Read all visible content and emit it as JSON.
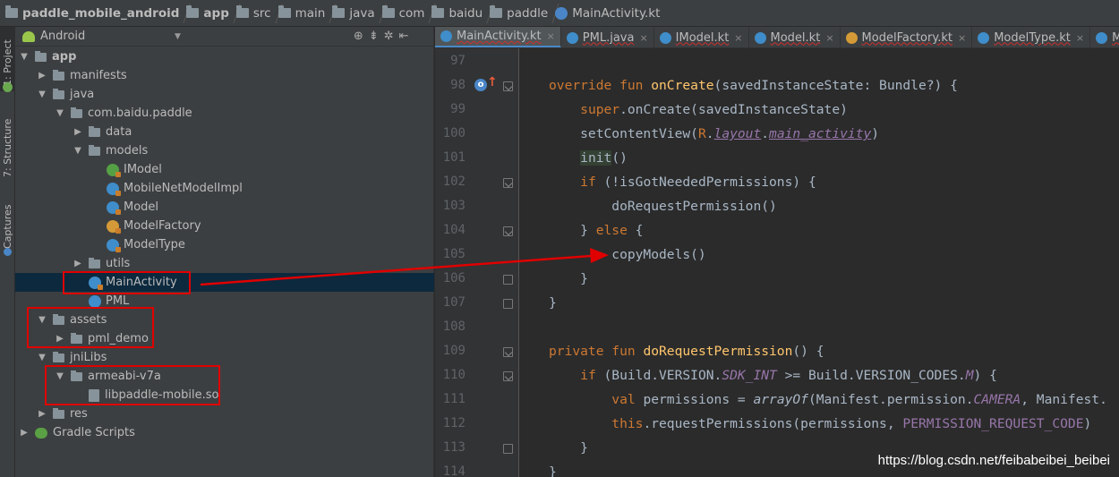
{
  "breadcrumb": [
    {
      "label": "paddle_mobile_android",
      "bold": true,
      "icon": "project-folder-icon"
    },
    {
      "label": "app",
      "bold": true,
      "icon": "module-folder-icon"
    },
    {
      "label": "src",
      "bold": false,
      "icon": "folder-icon"
    },
    {
      "label": "main",
      "bold": false,
      "icon": "folder-icon"
    },
    {
      "label": "java",
      "bold": false,
      "icon": "folder-icon"
    },
    {
      "label": "com",
      "bold": false,
      "icon": "folder-icon"
    },
    {
      "label": "baidu",
      "bold": false,
      "icon": "folder-icon"
    },
    {
      "label": "paddle",
      "bold": false,
      "icon": "folder-icon"
    },
    {
      "label": "MainActivity.kt",
      "bold": false,
      "icon": "kotlin-class-icon"
    }
  ],
  "toolstrip": {
    "project_tab": "1: Project",
    "structure_tab": "7: Structure",
    "captures_tab": "Captures"
  },
  "project_panel": {
    "view_mode": "Android",
    "tree": [
      {
        "label": "app",
        "bold": true,
        "arrow": "down",
        "indent": 0,
        "icon": "module"
      },
      {
        "label": "manifests",
        "arrow": "right",
        "indent": 1,
        "icon": "folder"
      },
      {
        "label": "java",
        "arrow": "down",
        "indent": 1,
        "icon": "folder"
      },
      {
        "label": "com.baidu.paddle",
        "arrow": "down",
        "indent": 2,
        "icon": "folder"
      },
      {
        "label": "data",
        "arrow": "right",
        "indent": 3,
        "icon": "folder"
      },
      {
        "label": "models",
        "arrow": "down",
        "indent": 3,
        "icon": "folder"
      },
      {
        "label": "IModel",
        "arrow": "",
        "indent": 4,
        "icon": "interface"
      },
      {
        "label": "MobileNetModelImpl",
        "arrow": "",
        "indent": 4,
        "icon": "class"
      },
      {
        "label": "Model",
        "arrow": "",
        "indent": 4,
        "icon": "class"
      },
      {
        "label": "ModelFactory",
        "arrow": "",
        "indent": 4,
        "icon": "class-orange"
      },
      {
        "label": "ModelType",
        "arrow": "",
        "indent": 4,
        "icon": "class"
      },
      {
        "label": "utils",
        "arrow": "right",
        "indent": 3,
        "icon": "folder"
      },
      {
        "label": "MainActivity",
        "arrow": "",
        "indent": 3,
        "icon": "class",
        "selected": true
      },
      {
        "label": "PML",
        "arrow": "",
        "indent": 3,
        "icon": "class-java"
      },
      {
        "label": "assets",
        "arrow": "down",
        "indent": 1,
        "icon": "folder"
      },
      {
        "label": "pml_demo",
        "arrow": "right",
        "indent": 2,
        "icon": "folder"
      },
      {
        "label": "jniLibs",
        "arrow": "down",
        "indent": 1,
        "icon": "folder"
      },
      {
        "label": "armeabi-v7a",
        "arrow": "down",
        "indent": 2,
        "icon": "folder"
      },
      {
        "label": "libpaddle-mobile.so",
        "arrow": "",
        "indent": 3,
        "icon": "so-file"
      },
      {
        "label": "res",
        "arrow": "right",
        "indent": 1,
        "icon": "folder"
      },
      {
        "label": "Gradle Scripts",
        "arrow": "right",
        "indent": 0,
        "icon": "gradle"
      }
    ]
  },
  "tabs": [
    {
      "label": "MainActivity.kt",
      "active": true,
      "icon": "kotlin-class-icon"
    },
    {
      "label": "PML.java",
      "active": false,
      "icon": "java-class-icon"
    },
    {
      "label": "IModel.kt",
      "active": false,
      "icon": "interface-icon"
    },
    {
      "label": "Model.kt",
      "active": false,
      "icon": "kotlin-class-icon"
    },
    {
      "label": "ModelFactory.kt",
      "active": false,
      "icon": "kotlin-class-orange-icon"
    },
    {
      "label": "ModelType.kt",
      "active": false,
      "icon": "kotlin-class-icon"
    },
    {
      "label": "Mo",
      "active": false,
      "icon": "kotlin-class-icon"
    }
  ],
  "editor": {
    "line_numbers": [
      "97",
      "98",
      "99",
      "100",
      "101",
      "102",
      "103",
      "104",
      "105",
      "106",
      "107",
      "108",
      "109",
      "110",
      "111",
      "112",
      "113",
      "114"
    ],
    "override_marker": "o"
  },
  "watermark": "https://blog.csdn.net/feibabeibei_beibei"
}
